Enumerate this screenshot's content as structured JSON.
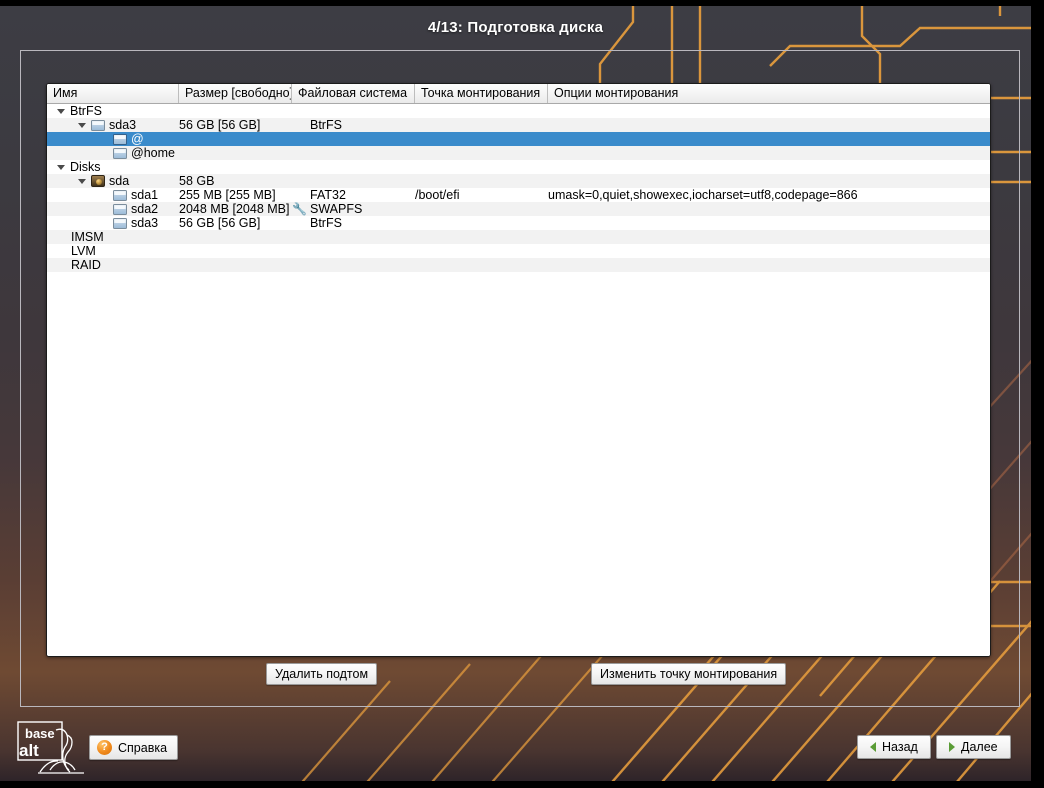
{
  "window": {
    "title": "4/13: Подготовка диска"
  },
  "table": {
    "columns": [
      "Имя",
      "Размер [свободно]",
      "Файловая система",
      "Точка монтирования",
      "Опции монтирования"
    ],
    "rows": [
      {
        "indent": 0,
        "arrow": "down",
        "icon": "none",
        "name": "BtrFS",
        "size": "",
        "fs": "",
        "fs_icon": "none",
        "mount": "",
        "options": ""
      },
      {
        "indent": 1,
        "arrow": "down",
        "icon": "partition",
        "name": "sda3",
        "size": "56 GB [56 GB]",
        "fs": "BtrFS",
        "fs_icon": "none",
        "mount": "",
        "options": ""
      },
      {
        "indent": 2,
        "arrow": "none",
        "icon": "partition",
        "name": "@",
        "size": "",
        "fs": "",
        "fs_icon": "none",
        "mount": "",
        "options": ""
      },
      {
        "indent": 2,
        "arrow": "none",
        "icon": "partition",
        "name": "@home",
        "size": "",
        "fs": "",
        "fs_icon": "none",
        "mount": "",
        "options": ""
      },
      {
        "indent": 0,
        "arrow": "down",
        "icon": "none",
        "name": "Disks",
        "size": "",
        "fs": "",
        "fs_icon": "none",
        "mount": "",
        "options": ""
      },
      {
        "indent": 1,
        "arrow": "down",
        "icon": "disk",
        "name": "sda",
        "size": "58 GB",
        "fs": "",
        "fs_icon": "none",
        "mount": "",
        "options": ""
      },
      {
        "indent": 2,
        "arrow": "none",
        "icon": "partition",
        "name": "sda1",
        "size": "255 MB [255 MB]",
        "fs": "FAT32",
        "fs_icon": "none",
        "mount": "/boot/efi",
        "options": "umask=0,quiet,showexec,iocharset=utf8,codepage=866"
      },
      {
        "indent": 2,
        "arrow": "none",
        "icon": "partition",
        "name": "sda2",
        "size": "2048 MB [2048 MB]",
        "fs": "SWAPFS",
        "fs_icon": "wrench",
        "mount": "",
        "options": ""
      },
      {
        "indent": 2,
        "arrow": "none",
        "icon": "partition",
        "name": "sda3",
        "size": "56 GB [56 GB]",
        "fs": "BtrFS",
        "fs_icon": "none",
        "mount": "",
        "options": ""
      },
      {
        "indent": 0,
        "arrow": "none",
        "icon": "none",
        "name": "IMSM",
        "size": "",
        "fs": "",
        "fs_icon": "none",
        "mount": "",
        "options": ""
      },
      {
        "indent": 0,
        "arrow": "none",
        "icon": "none",
        "name": "LVM",
        "size": "",
        "fs": "",
        "fs_icon": "none",
        "mount": "",
        "options": ""
      },
      {
        "indent": 0,
        "arrow": "none",
        "icon": "none",
        "name": "RAID",
        "size": "",
        "fs": "",
        "fs_icon": "none",
        "mount": "",
        "options": ""
      }
    ],
    "selected_row_index": 2
  },
  "actions": {
    "delete_subvolume": "Удалить подтом",
    "change_mount_point": "Изменить точку монтирования"
  },
  "footer": {
    "logo_line1": "base",
    "logo_line2": "alt",
    "help": "Справка",
    "help_icon_glyph": "?",
    "back": "Назад",
    "next": "Далее"
  },
  "colors": {
    "selection_blue": "#3a8bcb",
    "accent_orange": "#e39b3d",
    "arrow_green": "#5a9c36",
    "help_orange": "#f08a1c"
  }
}
